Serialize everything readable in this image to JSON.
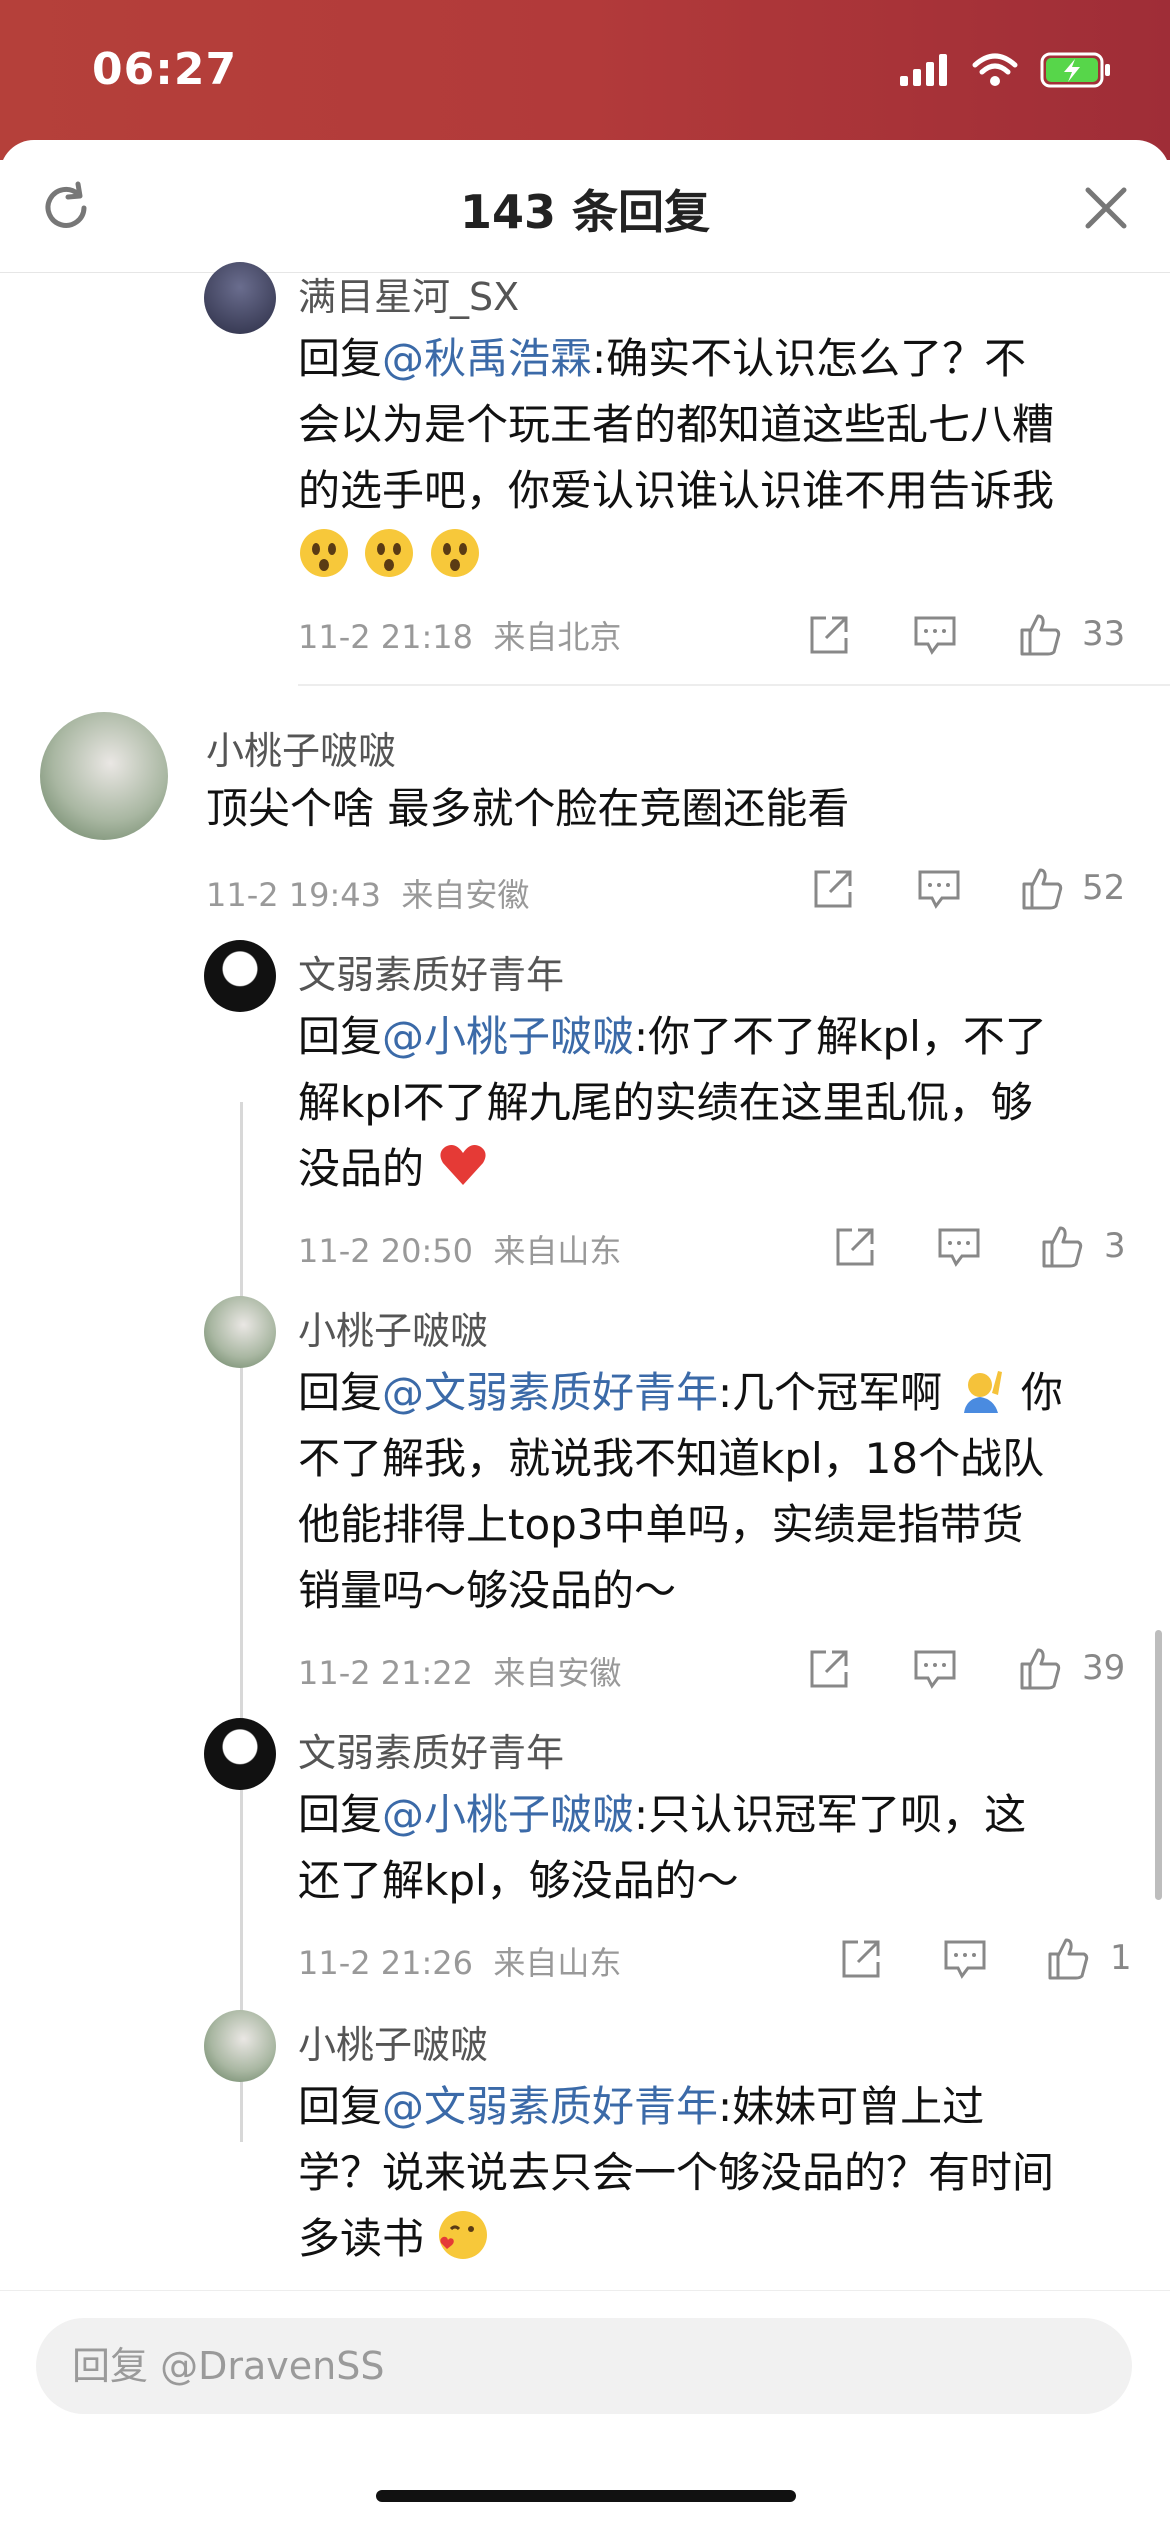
{
  "status_bar": {
    "time": "06:27"
  },
  "header": {
    "title": "143 条回复"
  },
  "comments": [
    {
      "user": "满目星河_SX",
      "reply_prefix": "回复",
      "mention": "@秋禹浩霖",
      "text_line1_after": ":确实不认识怎么了？不",
      "text_line2": "会以为是个玩王者的都知道这些乱七八糟",
      "text_line3": "的选手吧，你爱认识谁认识谁不用告诉我",
      "emojis": [
        "astonished-face",
        "astonished-face",
        "astonished-face"
      ],
      "time": "11-2 21:18",
      "location": "来自北京",
      "likes": "33"
    },
    {
      "user": "小桃子啵啵",
      "text": "顶尖个啥 最多就个脸在竞圈还能看",
      "time": "11-2 19:43",
      "location": "来自安徽",
      "likes": "52"
    },
    {
      "user": "文弱素质好青年",
      "reply_prefix": "回复",
      "mention": "@小桃子啵啵",
      "text_line1_after": ":你了不了解kpl，不了",
      "text_line2": "解kpl不了解九尾的实绩在这里乱侃，够",
      "text_line3": "没品的",
      "emojis": [
        "red-heart"
      ],
      "time": "11-2 20:50",
      "location": "来自山东",
      "likes": "3"
    },
    {
      "user": "小桃子啵啵",
      "reply_prefix": "回复",
      "mention": "@文弱素质好青年",
      "text_line1_after": ":几个冠军啊",
      "text_line1_tail": "你",
      "text_line2": "不了解我，就说我不知道kpl，18个战队",
      "text_line3": "他能排得上top3中单吗，实绩是指带货",
      "text_line4": "销量吗～够没品的～",
      "emojis": [
        "person-raising-hand"
      ],
      "time": "11-2 21:22",
      "location": "来自安徽",
      "likes": "39"
    },
    {
      "user": "文弱素质好青年",
      "reply_prefix": "回复",
      "mention": "@小桃子啵啵",
      "text_line1_after": ":只认识冠军了呗，这",
      "text_line2": "还了解kpl，够没品的～",
      "time": "11-2 21:26",
      "location": "来自山东",
      "likes": "1"
    },
    {
      "user": "小桃子啵啵",
      "reply_prefix": "回复",
      "mention": "@文弱素质好青年",
      "text_line1_after": ":妹妹可曾上过",
      "text_line2": "学？说来说去只会一个够没品的？有时间",
      "text_line3": "多读书",
      "emojis": [
        "face-blowing-kiss"
      ]
    }
  ],
  "reply_bar": {
    "placeholder": "回复 @DravenSS"
  },
  "colors": {
    "mention": "#3b6aa8",
    "status_bar": "#b23a3a"
  }
}
